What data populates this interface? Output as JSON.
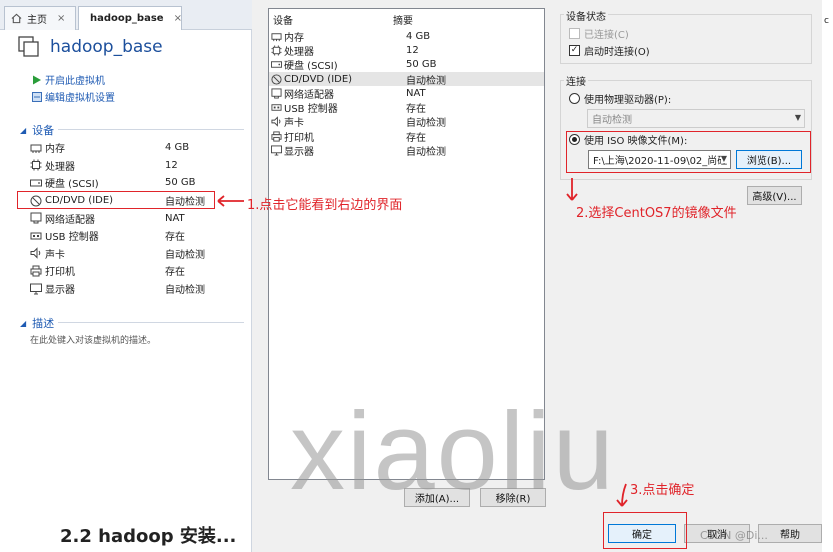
{
  "left_panel": {
    "tabs": [
      {
        "label": "主页",
        "close": "×"
      },
      {
        "label": "hadoop_base",
        "close": "×"
      }
    ],
    "vm_title": "hadoop_base",
    "actions": [
      "开启此虚拟机",
      "编辑虚拟机设置"
    ],
    "devices_section": "设备",
    "devices": [
      {
        "name": "内存",
        "value": "4 GB",
        "icon": "memory-icon"
      },
      {
        "name": "处理器",
        "value": "12",
        "icon": "cpu-icon"
      },
      {
        "name": "硬盘 (SCSI)",
        "value": "50 GB",
        "icon": "harddisk-icon"
      },
      {
        "name": "CD/DVD (IDE)",
        "value": "自动检测",
        "icon": "cd-dvd-icon"
      },
      {
        "name": "网络适配器",
        "value": "NAT",
        "icon": "network-icon"
      },
      {
        "name": "USB 控制器",
        "value": "存在",
        "icon": "usb-icon"
      },
      {
        "name": "声卡",
        "value": "自动检测",
        "icon": "sound-icon"
      },
      {
        "name": "打印机",
        "value": "存在",
        "icon": "printer-icon"
      },
      {
        "name": "显示器",
        "value": "自动检测",
        "icon": "monitor-icon"
      }
    ],
    "description_section": "描述",
    "description_placeholder": "在此处键入对该虚拟机的描述。",
    "bottom_text": "2.2 hadoop 安装..."
  },
  "dialog": {
    "list_headers": {
      "device": "设备",
      "summary": "摘要"
    },
    "hardware": [
      {
        "name": "内存",
        "value": "4 GB",
        "icon": "memory-icon"
      },
      {
        "name": "处理器",
        "value": "12",
        "icon": "cpu-icon"
      },
      {
        "name": "硬盘 (SCSI)",
        "value": "50 GB",
        "icon": "harddisk-icon"
      },
      {
        "name": "CD/DVD (IDE)",
        "value": "自动检测",
        "icon": "cd-dvd-icon"
      },
      {
        "name": "网络适配器",
        "value": "NAT",
        "icon": "network-icon"
      },
      {
        "name": "USB 控制器",
        "value": "存在",
        "icon": "usb-icon"
      },
      {
        "name": "声卡",
        "value": "自动检测",
        "icon": "sound-icon"
      },
      {
        "name": "打印机",
        "value": "存在",
        "icon": "printer-icon"
      },
      {
        "name": "显示器",
        "value": "自动检测",
        "icon": "monitor-icon"
      }
    ],
    "selected_index": 3,
    "add_button": "添加(A)...",
    "remove_button": "移除(R)",
    "status_group": "设备状态",
    "connected": "已连接(C)",
    "connect_at_power_on": "启动时连接(O)",
    "connection_group": "连接",
    "use_physical": "使用物理驱动器(P):",
    "physical_value": "自动检测",
    "use_iso": "使用 ISO 映像文件(M):",
    "iso_path": "F:\\上海\\2020-11-09\\02_尚硅",
    "browse_button": "浏览(B)...",
    "advanced_button": "高级(V)...",
    "ok_button": "确定",
    "cancel_button": "取消",
    "help_button": "帮助"
  },
  "annotations": {
    "step1": "1.点击它能看到右边的界面",
    "step2": "2.选择CentOS7的镜像文件",
    "step3": "3.点击确定",
    "watermark": "xiaoliu",
    "csdn": "CSDN @Di..."
  },
  "colors": {
    "annotation_red": "#e0242a",
    "link_blue": "#1f5bb3",
    "title_blue": "#1c4f9c"
  }
}
